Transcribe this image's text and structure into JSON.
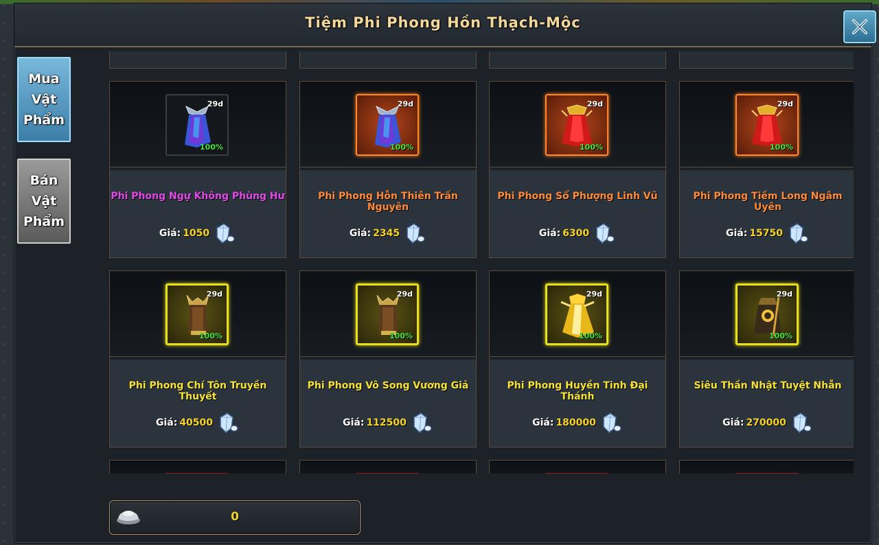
{
  "window": {
    "title": "Tiệm Phi Phong Hồn Thạch-Mộc"
  },
  "tabs": [
    {
      "lines": [
        "Mua",
        "Vật",
        "Phẩm"
      ]
    },
    {
      "lines": [
        "Bán",
        "Vật",
        "Phẩm"
      ]
    }
  ],
  "price_label": "Giá:",
  "items": [
    {
      "name": "Phi Phong Ngự Không Phùng Hư",
      "price": "1050",
      "days": "29d",
      "durability": "100%",
      "name_color": "#e24ae8",
      "frame": "dark",
      "art": "blue-cape"
    },
    {
      "name": "Phi Phong Hỗn Thiên Trấn Nguyên",
      "price": "2345",
      "days": "29d",
      "durability": "100%",
      "name_color": "#ff8a3a",
      "frame": "orange",
      "art": "blue-cape"
    },
    {
      "name": "Phi Phong Sổ Phượng Linh Vũ",
      "price": "6300",
      "days": "29d",
      "durability": "100%",
      "name_color": "#ff8a3a",
      "frame": "orange",
      "art": "red-cape"
    },
    {
      "name": "Phi Phong Tiềm Long Ngâm Uyên",
      "price": "15750",
      "days": "29d",
      "durability": "100%",
      "name_color": "#ff8a3a",
      "frame": "orange",
      "art": "red-cape"
    },
    {
      "name": "Phi Phong Chí Tôn Truyền Thuyết",
      "price": "40500",
      "days": "29d",
      "durability": "100%",
      "name_color": "#f7e23a",
      "frame": "yellow",
      "art": "brown-cape"
    },
    {
      "name": "Phi Phong Vô Song Vương Giả",
      "price": "112500",
      "days": "29d",
      "durability": "100%",
      "name_color": "#f7e23a",
      "frame": "yellow",
      "art": "brown-cape"
    },
    {
      "name": "Phi Phong Huyền Tinh Đại Thánh",
      "price": "180000",
      "days": "29d",
      "durability": "100%",
      "name_color": "#f7e23a",
      "frame": "yellow",
      "art": "gold-cape"
    },
    {
      "name": "Siêu Thần Nhật Tuyệt Nhẫn",
      "price": "270000",
      "days": "29d",
      "durability": "100%",
      "name_color": "#f7e23a",
      "frame": "yellow",
      "art": "dark-cape"
    }
  ],
  "currency": {
    "amount": "0",
    "icon": "silver-ingot-icon"
  },
  "colors": {
    "accent_gold": "#f3d79b",
    "price": "#f7d22a",
    "durability": "#45e33a"
  }
}
